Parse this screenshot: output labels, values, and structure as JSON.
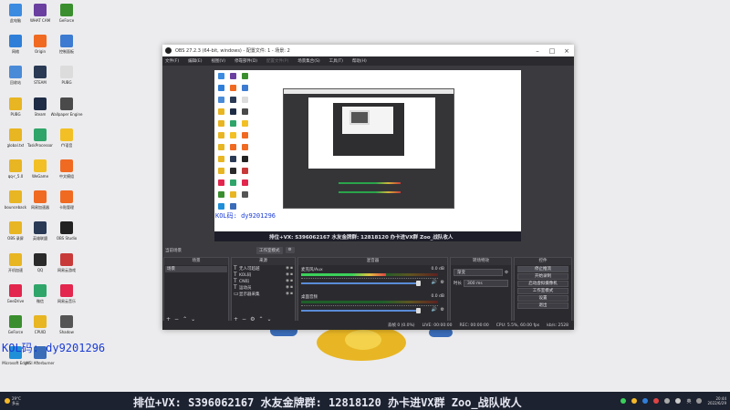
{
  "desktop": {
    "icons": [
      {
        "label": "此电脑",
        "color": "#3b8be0"
      },
      {
        "label": "WHAT CAM",
        "color": "#6a3fa0"
      },
      {
        "label": "GeForce",
        "color": "#3a8e2e"
      },
      {
        "label": "网络",
        "color": "#2f7fd8"
      },
      {
        "label": "Origin",
        "color": "#f06a22"
      },
      {
        "label": "控制面板",
        "color": "#3c7bd1"
      },
      {
        "label": "回收站",
        "color": "#4a8bd8"
      },
      {
        "label": "STEAM",
        "color": "#2a3a55"
      },
      {
        "label": "PUBG",
        "color": "#dcdcdc"
      },
      {
        "label": "PUBG",
        "color": "#e8b523"
      },
      {
        "label": "Steam",
        "color": "#1f2c45"
      },
      {
        "label": "Wallpaper Engine",
        "color": "#4a4a4a"
      },
      {
        "label": "global.txt",
        "color": "#e8b523"
      },
      {
        "label": "TaskProcessor",
        "color": "#2fa56a"
      },
      {
        "label": "YY语音",
        "color": "#f2c024"
      },
      {
        "label": "qq-r_5.0",
        "color": "#e8b523"
      },
      {
        "label": "WeGame",
        "color": "#f2c024"
      },
      {
        "label": "中文模组",
        "color": "#f06a22"
      },
      {
        "label": "bounceback",
        "color": "#e8b523"
      },
      {
        "label": "网易加速器",
        "color": "#f06a22"
      },
      {
        "label": "卡贴管理",
        "color": "#f06a22"
      },
      {
        "label": "OBS 录屏",
        "color": "#e8b523"
      },
      {
        "label": "英雄联盟",
        "color": "#2a3a55"
      },
      {
        "label": "OBS Studio",
        "color": "#222222"
      },
      {
        "label": "开机加速",
        "color": "#e8b523"
      },
      {
        "label": "QQ",
        "color": "#2a2a2a"
      },
      {
        "label": "网易云游戏",
        "color": "#c83a3a"
      },
      {
        "label": "GeeDrive",
        "color": "#e2264d"
      },
      {
        "label": "微信",
        "color": "#2fa56a"
      },
      {
        "label": "网易云音乐",
        "color": "#e2264d"
      },
      {
        "label": "GeForce",
        "color": "#3a8e2e"
      },
      {
        "label": "CPUID",
        "color": "#e8b523"
      },
      {
        "label": "Shadow",
        "color": "#555555"
      },
      {
        "label": "Microsoft Edge",
        "color": "#1f8fd8"
      },
      {
        "label": "MSI Afterburner",
        "color": "#3a6cb8"
      }
    ],
    "watermark": "KOL码: dy9201296"
  },
  "obs": {
    "title": "OBS 27.2.3 (64-bit, windows) - 配置文件: 1 - 场景: 2",
    "menu": [
      {
        "label": "文件(F)",
        "disabled": false
      },
      {
        "label": "编辑(E)",
        "disabled": false
      },
      {
        "label": "视图(V)",
        "disabled": false
      },
      {
        "label": "停靠部件(D)",
        "disabled": false
      },
      {
        "label": "配置文件(P)",
        "disabled": true
      },
      {
        "label": "场景集合(S)",
        "disabled": false
      },
      {
        "label": "工具(T)",
        "disabled": false
      },
      {
        "label": "帮助(H)",
        "disabled": false
      }
    ],
    "preview_watermark": "KOL码: dy9201296",
    "preview_banner": "排位+VX: S396062167 水友金牌群: 12818120 办卡进VX群 Zoo_战队收人",
    "current_scene": "当前场景",
    "studio_mode_btn": "工作室模式",
    "scenes_header": "场景",
    "scenes": [
      "场景"
    ],
    "sources_header": "来源",
    "sources": [
      {
        "icon": "T",
        "label": "无人可超越"
      },
      {
        "icon": "T",
        "label": "KOL码"
      },
      {
        "icon": "T",
        "label": "CN码"
      },
      {
        "icon": "T",
        "label": "运动员"
      },
      {
        "icon": "▭",
        "label": "显示器采集"
      }
    ],
    "mixer_header": "混音器",
    "mixer": [
      {
        "name": "麦克风/Aux",
        "db": "0.0 dB",
        "level": 0.62
      },
      {
        "name": "桌面音频",
        "db": "0.0 dB",
        "level": 0.0
      }
    ],
    "transitions_header": "转场特效",
    "transition_type": "渐变",
    "duration_label": "时长",
    "duration_value": "300 ms",
    "controls_header": "控件",
    "controls": [
      "停止推流",
      "开始录制",
      "启动虚拟摄像机",
      "工作室模式",
      "设置",
      "退出"
    ],
    "status": {
      "dropped": "丢帧 0 (0.0%)",
      "live": "LIVE: 00:00:00",
      "rec": "REC: 00:00:00",
      "cpu": "CPU: 5.5%, 60.00 fps",
      "kbps": "kb/s: 2528"
    }
  },
  "taskbar": {
    "weather_temp": "29°C",
    "weather_text": "多云",
    "banner": "排位+VX: S396062167 水友金牌群: 12818120 办卡进VX群 Zoo_战队收人",
    "lang": "英",
    "time": "20:44",
    "date": "2022/6/29"
  },
  "colors": {
    "accent_meter_green": "#3bd05a",
    "accent_meter_yellow": "#e0c341",
    "accent_meter_red": "#e04444",
    "obs_dark": "#2b2b2f",
    "watermark_blue": "#1a3bd6"
  }
}
